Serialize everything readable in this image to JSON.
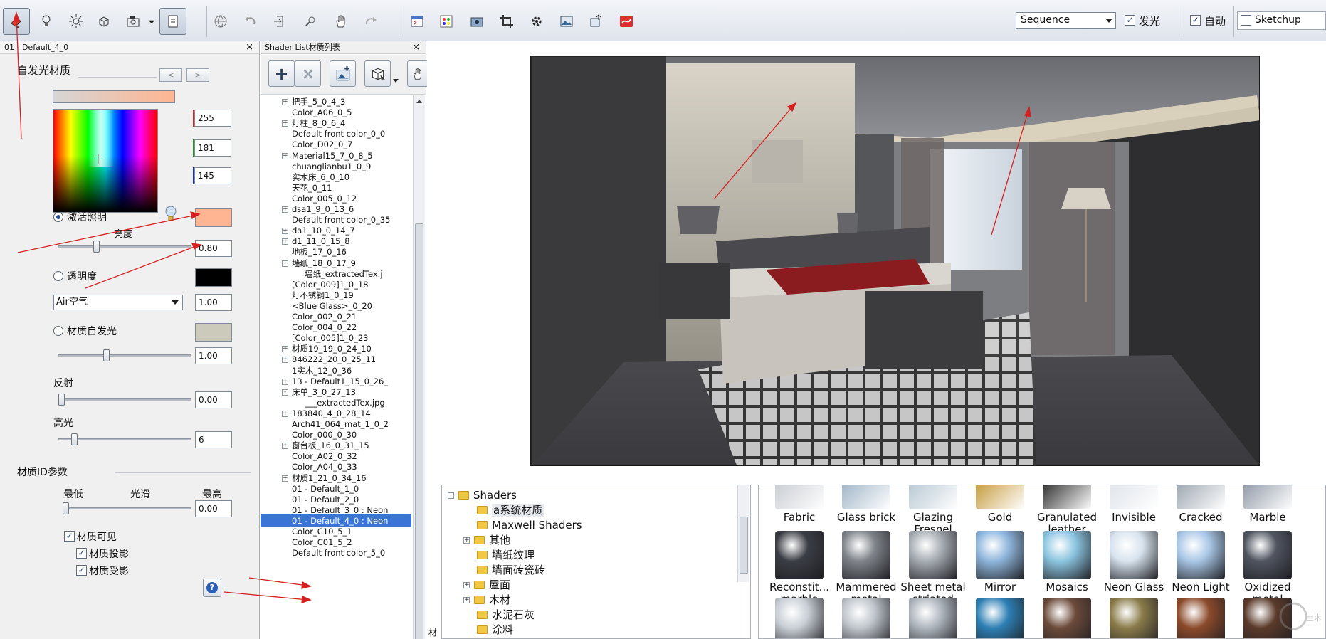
{
  "toolbar": {
    "sequence_select": "Sequence",
    "glow_checkbox": {
      "label": "发光",
      "checked": true
    },
    "auto_checkbox": {
      "label": "自动",
      "checked": true
    },
    "sketchup_checkbox": {
      "label": "Sketchup",
      "checked": false
    },
    "icons": [
      "material-icon",
      "light-bulb-icon",
      "sun-icon",
      "cube-icon",
      "camera-icon",
      "dropdown-icon",
      "panel-icon",
      "globe-icon",
      "undo-icon",
      "import-icon",
      "zoom-icon",
      "hand-icon",
      "redo-icon",
      "window-icon",
      "palette-icon",
      "render-icon",
      "crop-icon",
      "gear-icon",
      "image-icon",
      "export-icon",
      "logo-icon"
    ]
  },
  "material_panel": {
    "title": "01 - Default_4_0",
    "close": "×",
    "heading": "自发光材质",
    "prev": "<",
    "next": ">",
    "rgb": {
      "r": "255",
      "g": "181",
      "b": "145"
    },
    "activate_lighting": {
      "label": "激活照明",
      "selected": true
    },
    "brightness_label": "亮度",
    "brightness_value": "0.80",
    "brightness_level": 0.27,
    "transparency": {
      "label": "透明度",
      "selected": false
    },
    "medium_select": "Air空气",
    "medium_value": "1.00",
    "material_glow": {
      "label": "材质自发光",
      "selected": false
    },
    "material_glow_value": "1.00",
    "material_glow_level": 0.35,
    "reflection_label": "反射",
    "reflection_value": "0.00",
    "reflection_level": 0.0,
    "highlight_label": "高光",
    "highlight_value": "6",
    "highlight_level": 0.1,
    "id_params_heading": "材质ID参数",
    "min_label": "最低",
    "smooth_label": "光滑",
    "max_label": "最高",
    "smooth_value": "0.00",
    "smooth_level": 0.0,
    "visible": {
      "label": "材质可见",
      "checked": true
    },
    "cast_shadow": {
      "label": "材质投影",
      "checked": true
    },
    "receive_shadow": {
      "label": "材质受影",
      "checked": true
    },
    "help": "?",
    "colors": {
      "swatch": "#ffb591",
      "black": "#000000",
      "gray": "#cbcabb"
    }
  },
  "shader_list": {
    "title": "Shader List材质列表",
    "close": "×",
    "add": "+",
    "items": [
      {
        "label": "把手_5_0_4_3",
        "indent": 1,
        "expander": "+"
      },
      {
        "label": "Color_A06_0_5",
        "indent": 1,
        "expander": ""
      },
      {
        "label": "灯柱_8_0_6_4",
        "indent": 1,
        "expander": "+"
      },
      {
        "label": "Default front color_0_0",
        "indent": 1,
        "expander": ""
      },
      {
        "label": "Color_D02_0_7",
        "indent": 1,
        "expander": ""
      },
      {
        "label": "Material15_7_0_8_5",
        "indent": 1,
        "expander": "+"
      },
      {
        "label": "chuanglianbu1_0_9",
        "indent": 1,
        "expander": ""
      },
      {
        "label": "实木床_6_0_10",
        "indent": 1,
        "expander": ""
      },
      {
        "label": "天花_0_11",
        "indent": 1,
        "expander": ""
      },
      {
        "label": "Color_005_0_12",
        "indent": 1,
        "expander": ""
      },
      {
        "label": "dsa1_9_0_13_6",
        "indent": 1,
        "expander": "+"
      },
      {
        "label": "Default front color_0_35",
        "indent": 1,
        "expander": ""
      },
      {
        "label": "da1_10_0_14_7",
        "indent": 1,
        "expander": "+"
      },
      {
        "label": "d1_11_0_15_8",
        "indent": 1,
        "expander": "+"
      },
      {
        "label": "地板_17_0_16",
        "indent": 1,
        "expander": ""
      },
      {
        "label": "墙纸_18_0_17_9",
        "indent": 1,
        "expander": "-"
      },
      {
        "label": "墙纸_extractedTex.j",
        "indent": 2,
        "expander": ""
      },
      {
        "label": "[Color_009]1_0_18",
        "indent": 1,
        "expander": ""
      },
      {
        "label": "灯不锈钢1_0_19",
        "indent": 1,
        "expander": ""
      },
      {
        "label": "<Blue Glass>_0_20",
        "indent": 1,
        "expander": ""
      },
      {
        "label": "Color_002_0_21",
        "indent": 1,
        "expander": ""
      },
      {
        "label": "Color_004_0_22",
        "indent": 1,
        "expander": ""
      },
      {
        "label": "[Color_005]1_0_23",
        "indent": 1,
        "expander": ""
      },
      {
        "label": "材质19_19_0_24_10",
        "indent": 1,
        "expander": "+"
      },
      {
        "label": "846222_20_0_25_11",
        "indent": 1,
        "expander": "+"
      },
      {
        "label": "1实木_12_0_36",
        "indent": 1,
        "expander": ""
      },
      {
        "label": "13 - Default1_15_0_26_",
        "indent": 1,
        "expander": "+"
      },
      {
        "label": "床单_3_0_27_13",
        "indent": 1,
        "expander": "-"
      },
      {
        "label": "___extractedTex.jpg",
        "indent": 2,
        "expander": ""
      },
      {
        "label": "183840_4_0_28_14",
        "indent": 1,
        "expander": "+"
      },
      {
        "label": "Arch41_064_mat_1_0_2",
        "indent": 1,
        "expander": ""
      },
      {
        "label": "Color_000_0_30",
        "indent": 1,
        "expander": ""
      },
      {
        "label": "窗台板_16_0_31_15",
        "indent": 1,
        "expander": "+"
      },
      {
        "label": "Color_A02_0_32",
        "indent": 1,
        "expander": ""
      },
      {
        "label": "Color_A04_0_33",
        "indent": 1,
        "expander": ""
      },
      {
        "label": "材质1_21_0_34_16",
        "indent": 1,
        "expander": "+"
      },
      {
        "label": "01 - Default_1_0",
        "indent": 1,
        "expander": ""
      },
      {
        "label": "01 - Default_2_0",
        "indent": 1,
        "expander": ""
      },
      {
        "label": "01 - Default_3_0 : Neon",
        "indent": 1,
        "expander": ""
      },
      {
        "label": "01 - Default_4_0 : Neon",
        "indent": 1,
        "expander": "",
        "selected": true
      },
      {
        "label": "Color_C10_5_1",
        "indent": 1,
        "expander": ""
      },
      {
        "label": "Color_C01_5_2",
        "indent": 1,
        "expander": ""
      },
      {
        "label": "Default front color_5_0",
        "indent": 1,
        "expander": ""
      }
    ]
  },
  "shader_tree": {
    "items": [
      {
        "label": "Shaders",
        "level": 0,
        "expander": "-"
      },
      {
        "label": "a系统材质",
        "level": 1,
        "expander": "",
        "selected": true
      },
      {
        "label": "Maxwell Shaders",
        "level": 1,
        "expander": ""
      },
      {
        "label": "其他",
        "level": 1,
        "expander": "+"
      },
      {
        "label": "墙纸纹理",
        "level": 1,
        "expander": ""
      },
      {
        "label": "墙面砖瓷砖",
        "level": 1,
        "expander": ""
      },
      {
        "label": "屋面",
        "level": 1,
        "expander": "+"
      },
      {
        "label": "木材",
        "level": 1,
        "expander": "+"
      },
      {
        "label": "水泥石灰",
        "level": 1,
        "expander": ""
      },
      {
        "label": "涂料",
        "level": 1,
        "expander": ""
      }
    ],
    "left_tab": "材"
  },
  "thumbnails": [
    {
      "label": "Fabric",
      "color": "#c8ccd2"
    },
    {
      "label": "Glass brick",
      "color": "#9fb4c6"
    },
    {
      "label": "Glazing Fresnel",
      "color": "#b7c7d2"
    },
    {
      "label": "Gold",
      "color": "#c59a3a"
    },
    {
      "label": "Granulated leather",
      "color": "#2b2b2b"
    },
    {
      "label": "Invisible",
      "color": "#dfe4ea"
    },
    {
      "label": "Cracked",
      "color": "#9aa4ae"
    },
    {
      "label": "Marble",
      "color": "#8f98a6"
    },
    {
      "label": "Reconstit... marble",
      "color": "#3a3d44"
    },
    {
      "label": "Mammered metal",
      "color": "#7f848a"
    },
    {
      "label": "Sheet metal striated",
      "color": "#a7adb4"
    },
    {
      "label": "Mirror",
      "color": "#8fb6dc"
    },
    {
      "label": "Mosaics",
      "color": "#8cc5e0"
    },
    {
      "label": "Neon Glass",
      "color": "#d7e3ee"
    },
    {
      "label": "Neon Light",
      "color": "#a9c7e6"
    },
    {
      "label": "Oxidized metal",
      "color": "#505560"
    },
    {
      "label": "",
      "color": "#c9cfd6"
    },
    {
      "label": "",
      "color": "#bfc5cc"
    },
    {
      "label": "",
      "color": "#aeb5bd"
    },
    {
      "label": "",
      "color": "#2d7fb4"
    },
    {
      "label": "",
      "color": "#6b4a3a"
    },
    {
      "label": "",
      "color": "#8a7b4a"
    },
    {
      "label": "",
      "color": "#8b4a2a"
    },
    {
      "label": "",
      "color": "#5a3a2a"
    }
  ],
  "watermark": "土木在线"
}
